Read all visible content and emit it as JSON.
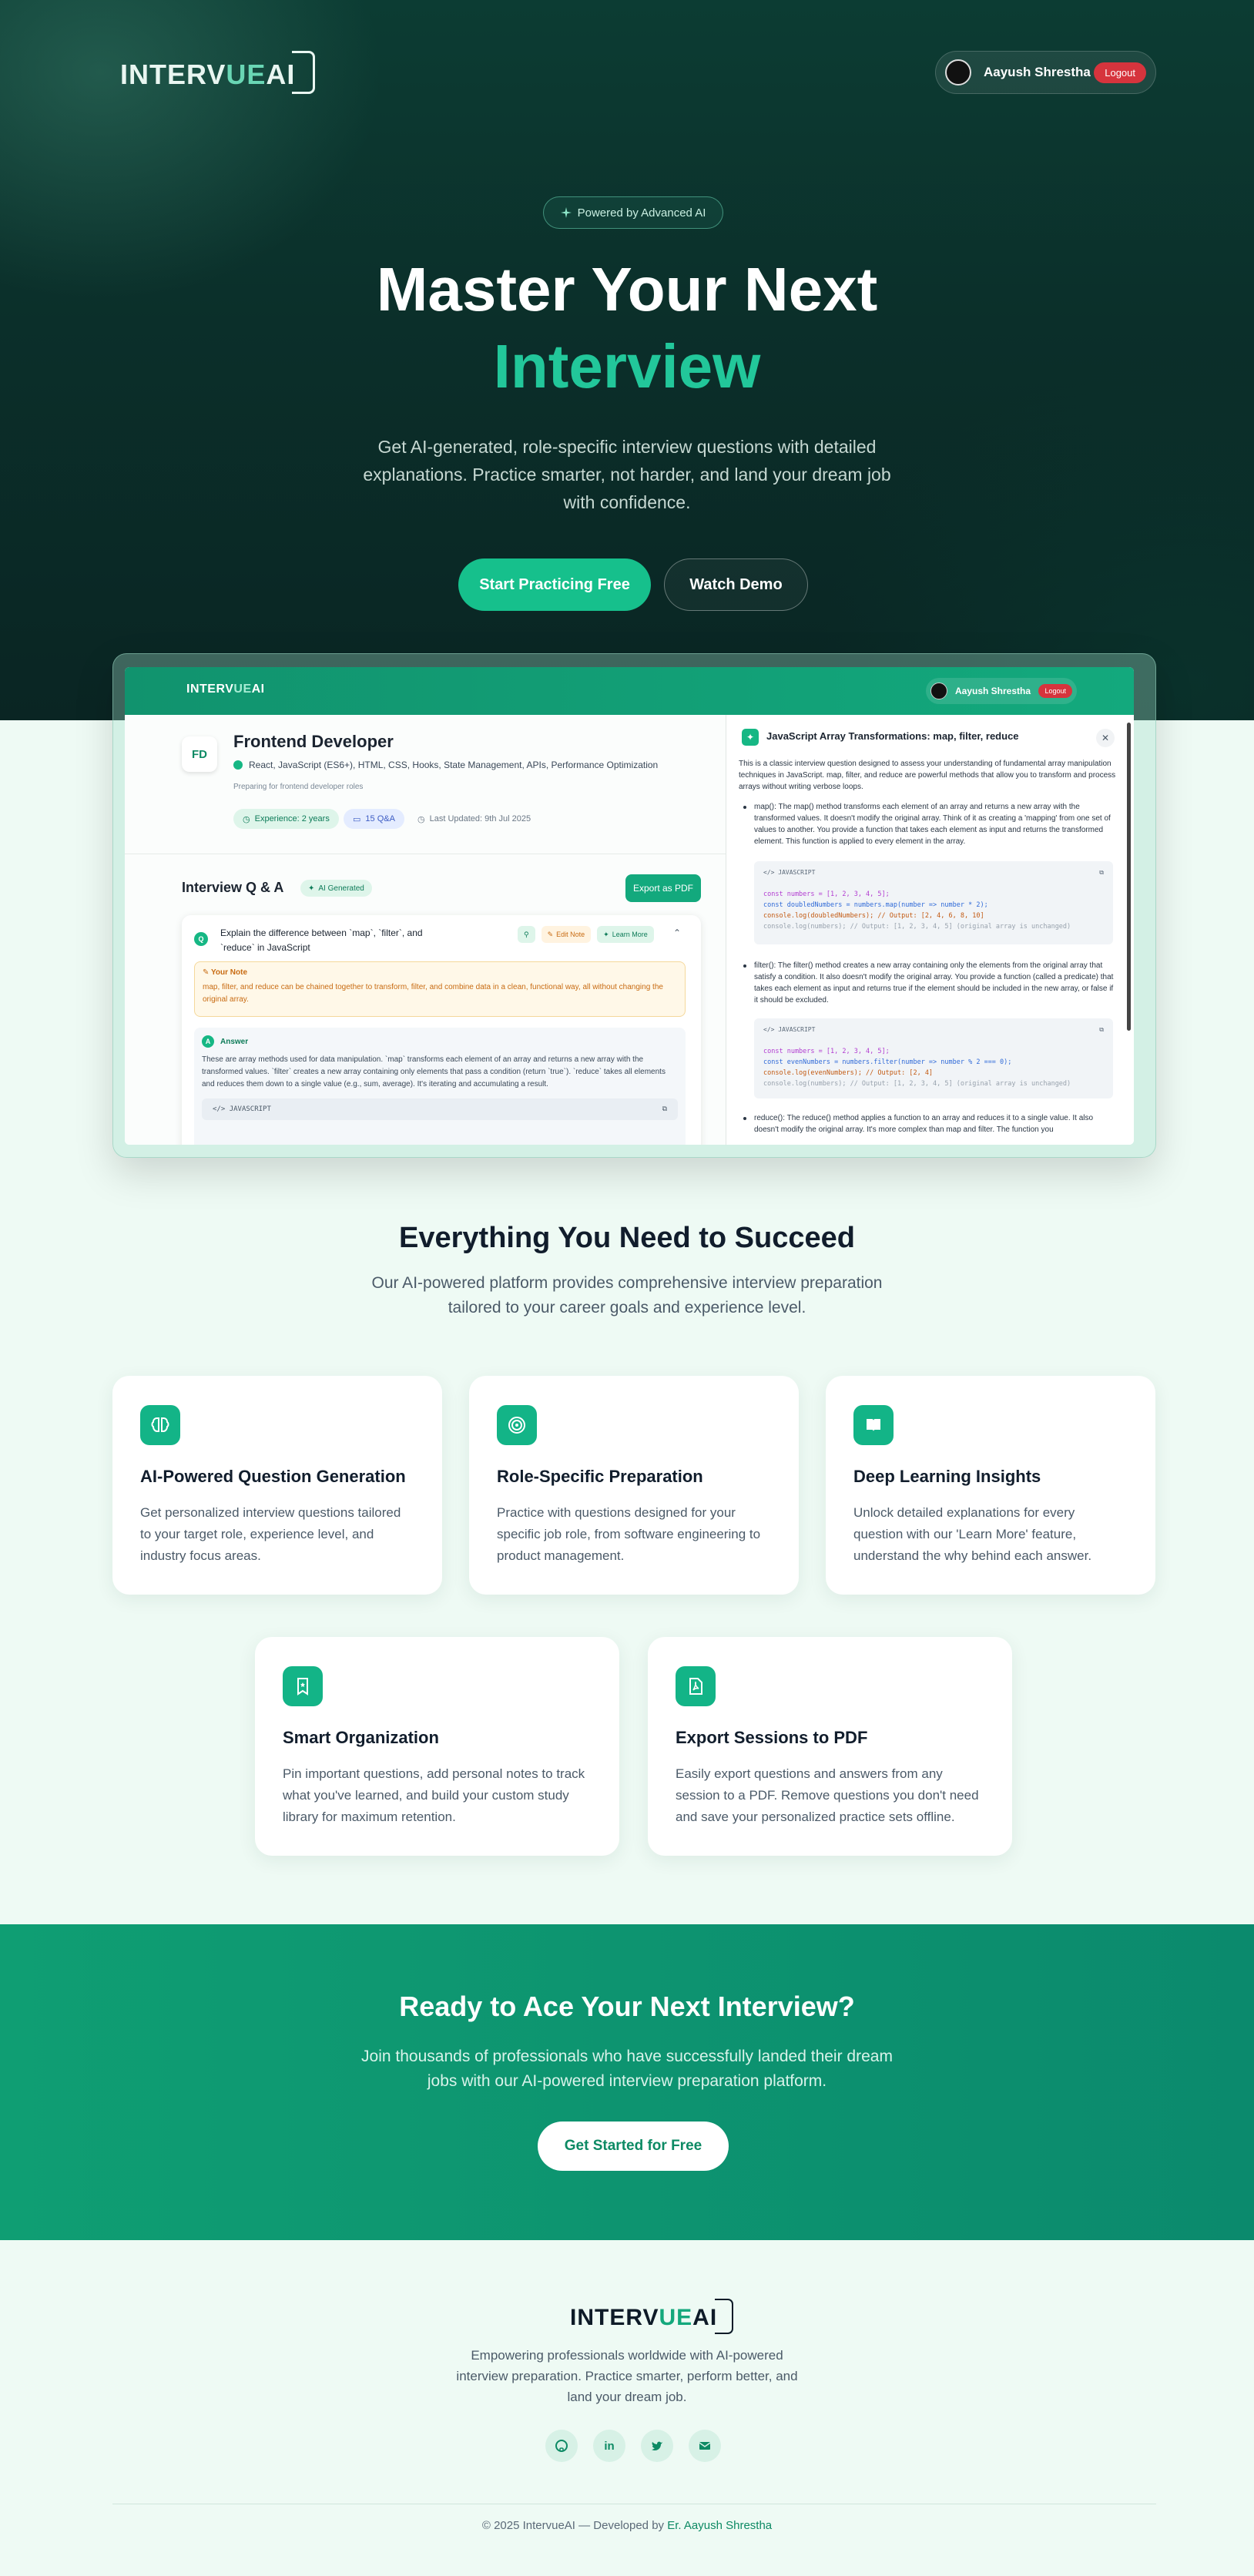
{
  "brand": {
    "logo_prefix": "INTERV",
    "logo_mid": "UE",
    "logo_suffix": "AI"
  },
  "user": {
    "name": "Aayush Shrestha",
    "logout": "Logout"
  },
  "hero": {
    "badge": "Powered by Advanced AI",
    "title_line1": "Master Your Next",
    "title_line2": "Interview",
    "subtitle": "Get AI-generated, role-specific interview questions with detailed explanations. Practice smarter, not harder, and land your dream job with confidence.",
    "primary_cta": "Start Practicing Free",
    "secondary_cta": "Watch Demo"
  },
  "preview": {
    "session": {
      "initials": "FD",
      "role": "Frontend Developer",
      "skills": "React, JavaScript (ES6+), HTML, CSS, Hooks, State Management, APIs, Performance Optimization",
      "description": "Preparing for frontend developer roles",
      "experience": "Experience: 2 years",
      "qa_count": "15 Q&A",
      "last_updated": "Last Updated: 9th Jul 2025"
    },
    "qa": {
      "title": "Interview Q & A",
      "ai_chip": "AI Generated",
      "export": "Export as PDF",
      "question": "Explain the difference between `map`, `filter`, and `reduce` in JavaScript",
      "edit_note": "Edit Note",
      "learn_more": "Learn More",
      "note_title": "Your Note",
      "note_body": "map, filter, and reduce can be chained together to transform, filter, and combine data in a clean, functional way, all without changing the original array.",
      "answer_label": "Answer",
      "answer_body": "These are array methods used for data manipulation. `map` transforms each element of an array and returns a new array with the transformed values. `filter` creates a new array containing only elements that pass a condition (return `true`). `reduce` takes all elements and reduces them down to a single value (e.g., sum, average). It's iterating and accumulating a result.",
      "code_label": "JAVASCRIPT"
    },
    "panel": {
      "title": "JavaScript Array Transformations: map, filter, reduce",
      "intro": "This is a classic interview question designed to assess your understanding of fundamental array manipulation techniques in JavaScript. map, filter, and reduce are powerful methods that allow you to transform and process arrays without writing verbose loops.",
      "map_text": "map(): The map() method transforms each element of an array and returns a new array with the transformed values. It doesn't modify the original array. Think of it as creating a 'mapping' from one set of values to another. You provide a function that takes each element as input and returns the transformed element. This function is applied to every element in the array.",
      "filter_text": "filter(): The filter() method creates a new array containing only the elements from the original array that satisfy a condition. It also doesn't modify the original array. You provide a function (called a predicate) that takes each element as input and returns true if the element should be included in the new array, or false if it should be excluded.",
      "reduce_text": "reduce(): The reduce() method applies a function to an array and reduces it to a single value. It also doesn't modify the original array. It's more complex than map and filter. The function you",
      "code_label": "JAVASCRIPT",
      "code1": [
        "const numbers = [1, 2, 3, 4, 5];",
        "const doubledNumbers = numbers.map(number => number * 2);",
        "console.log(doubledNumbers); // Output: [2, 4, 6, 8, 10]",
        "console.log(numbers); // Output: [1, 2, 3, 4, 5] (original array is unchanged)"
      ],
      "code2": [
        "const numbers = [1, 2, 3, 4, 5];",
        "const evenNumbers = numbers.filter(number => number % 2 === 0);",
        "console.log(evenNumbers); // Output: [2, 4]",
        "console.log(numbers); // Output: [1, 2, 3, 4, 5] (original array is unchanged)"
      ]
    }
  },
  "features": {
    "title": "Everything You Need to Succeed",
    "subtitle": "Our AI-powered platform provides comprehensive interview preparation tailored to your career goals and experience level.",
    "items": [
      {
        "icon": "brain-icon",
        "title": "AI-Powered Question Generation",
        "desc": "Get personalized interview questions tailored to your target role, experience level, and industry focus areas."
      },
      {
        "icon": "target-icon",
        "title": "Role-Specific Preparation",
        "desc": "Practice with questions designed for your specific job role, from software engineering to product management."
      },
      {
        "icon": "book-icon",
        "title": "Deep Learning Insights",
        "desc": "Unlock detailed explanations for every question with our 'Learn More' feature, understand the why behind each answer."
      },
      {
        "icon": "bookmark-icon",
        "title": "Smart Organization",
        "desc": "Pin important questions, add personal notes to track what you've learned, and build your custom study library for maximum retention."
      },
      {
        "icon": "pdf-file-icon",
        "title": "Export Sessions to PDF",
        "desc": "Easily export questions and answers from any session to a PDF. Remove questions you don't need and save your personalized practice sets offline."
      }
    ]
  },
  "cta": {
    "title": "Ready to Ace Your Next Interview?",
    "subtitle": "Join thousands of professionals who have successfully landed their dream jobs with our AI-powered interview preparation platform.",
    "button": "Get Started for Free"
  },
  "footer": {
    "tagline": "Empowering professionals worldwide with AI-powered interview preparation. Practice smarter, perform better, and land your dream job.",
    "copyright": "© 2025 IntervueAI — Developed by",
    "author": "Er. Aayush Shrestha"
  },
  "colors": {
    "accent": "#16c08c",
    "brand_dark": "#0c3c33",
    "logout": "#d6343d"
  }
}
